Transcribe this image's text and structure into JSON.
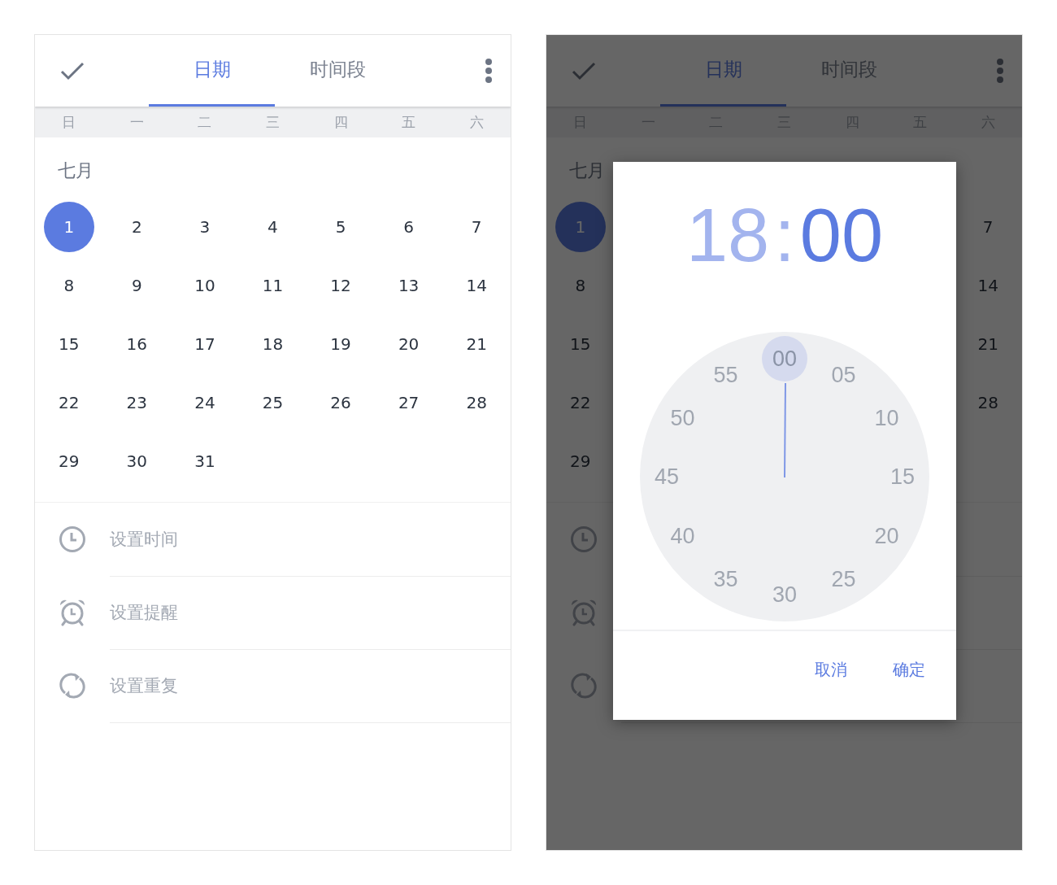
{
  "date_screen": {
    "tabs": [
      {
        "label": "日期",
        "selected": true
      },
      {
        "label": "时间段",
        "selected": false
      }
    ],
    "weekdays": [
      "日",
      "一",
      "二",
      "三",
      "四",
      "五",
      "六"
    ],
    "month": "七月",
    "days": [
      {
        "label": "1",
        "selected": true
      },
      {
        "label": "2",
        "selected": false
      },
      {
        "label": "3",
        "selected": false
      },
      {
        "label": "4",
        "selected": false
      },
      {
        "label": "5",
        "selected": false
      },
      {
        "label": "6",
        "selected": false
      },
      {
        "label": "7",
        "selected": false
      },
      {
        "label": "8",
        "selected": false
      },
      {
        "label": "9",
        "selected": false
      },
      {
        "label": "10",
        "selected": false
      },
      {
        "label": "11",
        "selected": false
      },
      {
        "label": "12",
        "selected": false
      },
      {
        "label": "13",
        "selected": false
      },
      {
        "label": "14",
        "selected": false
      },
      {
        "label": "15",
        "selected": false
      },
      {
        "label": "16",
        "selected": false
      },
      {
        "label": "17",
        "selected": false
      },
      {
        "label": "18",
        "selected": false
      },
      {
        "label": "19",
        "selected": false
      },
      {
        "label": "20",
        "selected": false
      },
      {
        "label": "21",
        "selected": false
      },
      {
        "label": "22",
        "selected": false
      },
      {
        "label": "23",
        "selected": false
      },
      {
        "label": "24",
        "selected": false
      },
      {
        "label": "25",
        "selected": false
      },
      {
        "label": "26",
        "selected": false
      },
      {
        "label": "27",
        "selected": false
      },
      {
        "label": "28",
        "selected": false
      },
      {
        "label": "29",
        "selected": false
      },
      {
        "label": "30",
        "selected": false
      },
      {
        "label": "31",
        "selected": false
      }
    ],
    "options": [
      {
        "kind": "clock",
        "label": "设置时间"
      },
      {
        "kind": "alarm",
        "label": "设置提醒"
      },
      {
        "kind": "repeat",
        "label": "设置重复"
      }
    ]
  },
  "time_screen": {
    "tabs": [
      {
        "label": "日期",
        "selected": true
      },
      {
        "label": "时间段",
        "selected": false
      }
    ],
    "weekdays": [
      "日",
      "一",
      "二",
      "三",
      "四",
      "五",
      "六"
    ],
    "month": "七月",
    "weeks": [
      {
        "first": {
          "label": "1",
          "selected": true
        },
        "last": {
          "label": "7",
          "selected": false
        }
      },
      {
        "first": {
          "label": "8",
          "selected": false
        },
        "last": {
          "label": "14",
          "selected": false
        }
      },
      {
        "first": {
          "label": "15",
          "selected": false
        },
        "last": {
          "label": "21",
          "selected": false
        }
      },
      {
        "first": {
          "label": "22",
          "selected": false
        },
        "last": {
          "label": "28",
          "selected": false
        }
      },
      {
        "first": {
          "label": "29",
          "selected": false
        }
      }
    ],
    "option_icons": [
      {
        "kind": "clock"
      },
      {
        "kind": "alarm"
      },
      {
        "kind": "repeat"
      }
    ],
    "dialog": {
      "hour": {
        "label": "18",
        "selected": false
      },
      "separator": ":",
      "minute": {
        "label": "00",
        "selected": true
      },
      "dial": [
        {
          "label": "00",
          "selected": true
        },
        {
          "label": "05",
          "selected": false
        },
        {
          "label": "10",
          "selected": false
        },
        {
          "label": "15",
          "selected": false
        },
        {
          "label": "20",
          "selected": false
        },
        {
          "label": "25",
          "selected": false
        },
        {
          "label": "30",
          "selected": false
        },
        {
          "label": "35",
          "selected": false
        },
        {
          "label": "40",
          "selected": false
        },
        {
          "label": "45",
          "selected": false
        },
        {
          "label": "50",
          "selected": false
        },
        {
          "label": "55",
          "selected": false
        }
      ],
      "buttons": [
        "取消",
        "确定"
      ]
    }
  }
}
